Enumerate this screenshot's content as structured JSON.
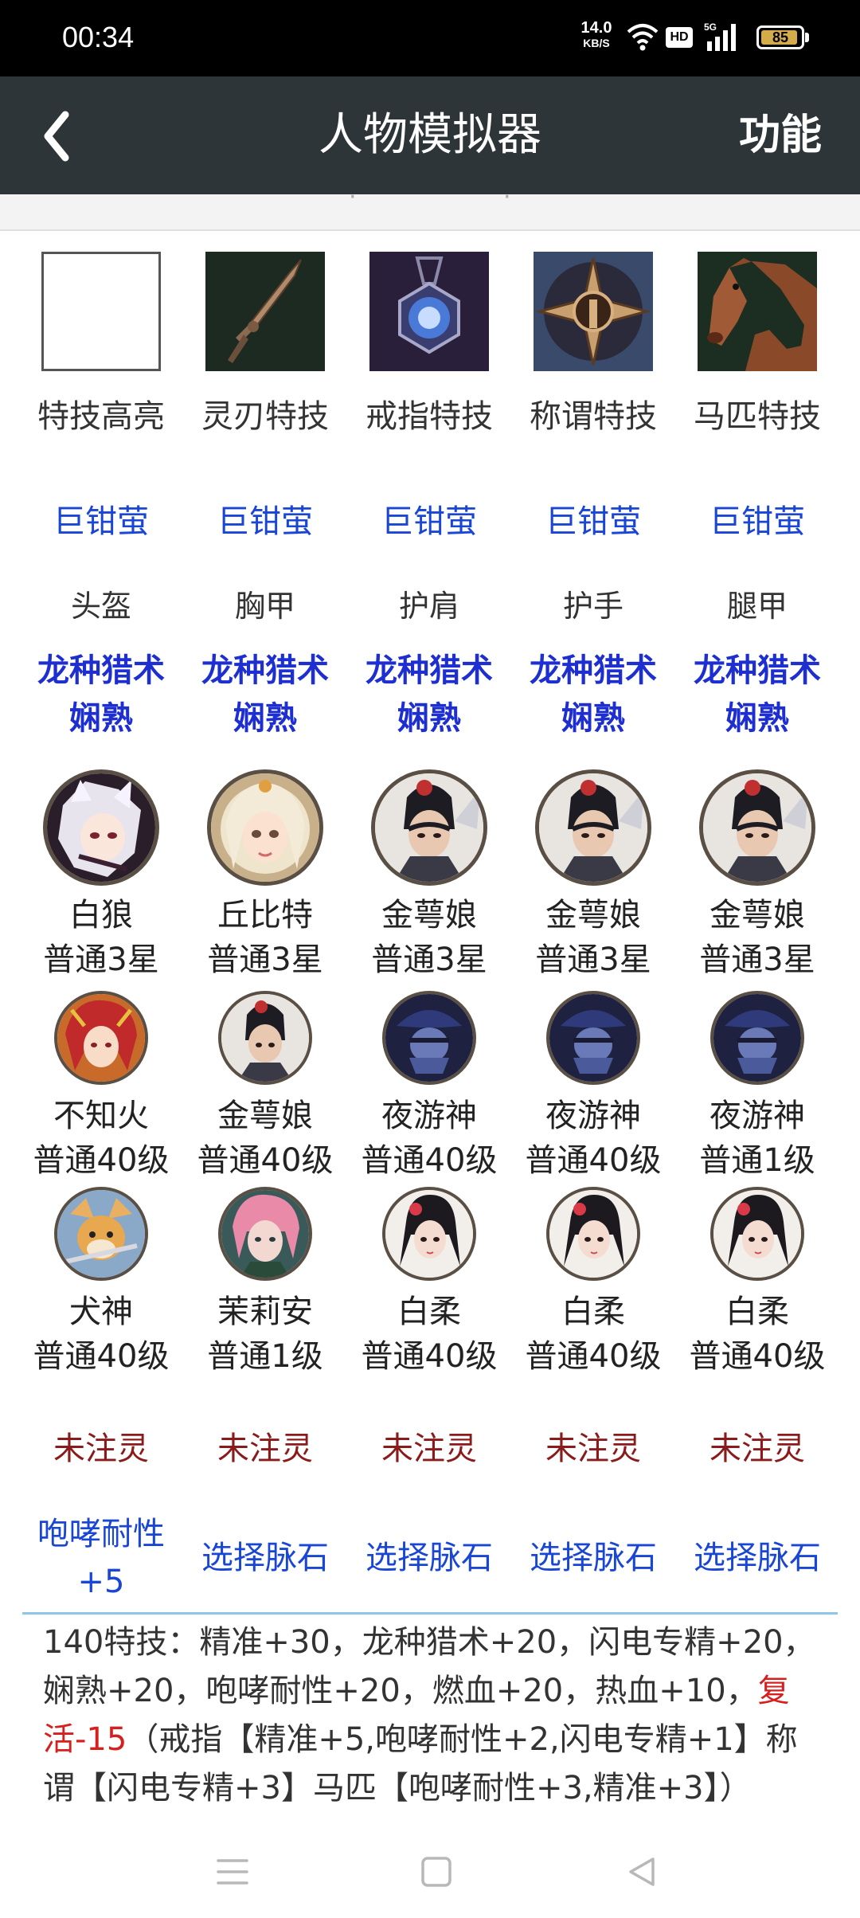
{
  "status_bar": {
    "time": "00:34",
    "net_speed": "14.0",
    "net_unit": "KB/S",
    "hd": "HD",
    "signal_label": "5G",
    "battery": "85"
  },
  "app_bar": {
    "title": "人物模拟器",
    "function_label": "功能"
  },
  "skills": [
    {
      "label": "特技高亮",
      "icon": "empty-box-icon"
    },
    {
      "label": "灵刃特技",
      "icon": "dagger-icon"
    },
    {
      "label": "戒指特技",
      "icon": "ring-icon"
    },
    {
      "label": "称谓特技",
      "icon": "emblem-icon"
    },
    {
      "label": "马匹特技",
      "icon": "horse-icon"
    }
  ],
  "set_links": [
    "巨钳萤",
    "巨钳萤",
    "巨钳萤",
    "巨钳萤",
    "巨钳萤"
  ],
  "gear_slots": [
    "头盔",
    "胸甲",
    "护肩",
    "护手",
    "腿甲"
  ],
  "gear_stats": [
    {
      "line1": "龙种猎术",
      "line2": "娴熟"
    },
    {
      "line1": "龙种猎术",
      "line2": "娴熟"
    },
    {
      "line1": "龙种猎术",
      "line2": "娴熟"
    },
    {
      "line1": "龙种猎术",
      "line2": "娴熟"
    },
    {
      "line1": "龙种猎术",
      "line2": "娴熟"
    }
  ],
  "companions_main": [
    {
      "name": "白狼",
      "grade": "普通3星",
      "avatar": "white-wolf-avatar-icon"
    },
    {
      "name": "丘比特",
      "grade": "普通3星",
      "avatar": "cupid-avatar-icon"
    },
    {
      "name": "金萼娘",
      "grade": "普通3星",
      "avatar": "jin-e-niang-avatar-icon"
    },
    {
      "name": "金萼娘",
      "grade": "普通3星",
      "avatar": "jin-e-niang-avatar-icon"
    },
    {
      "name": "金萼娘",
      "grade": "普通3星",
      "avatar": "jin-e-niang-avatar-icon"
    }
  ],
  "companions_row2": [
    {
      "name": "不知火",
      "grade": "普通40级",
      "avatar": "shiranui-avatar-icon"
    },
    {
      "name": "金萼娘",
      "grade": "普通40级",
      "avatar": "jin-e-niang-avatar-icon"
    },
    {
      "name": "夜游神",
      "grade": "普通40级",
      "avatar": "night-wanderer-avatar-icon"
    },
    {
      "name": "夜游神",
      "grade": "普通40级",
      "avatar": "night-wanderer-avatar-icon"
    },
    {
      "name": "夜游神",
      "grade": "普通1级",
      "avatar": "night-wanderer-avatar-icon"
    }
  ],
  "companions_row3": [
    {
      "name": "犬神",
      "grade": "普通40级",
      "avatar": "inugami-avatar-icon"
    },
    {
      "name": "茉莉安",
      "grade": "普通1级",
      "avatar": "marian-avatar-icon"
    },
    {
      "name": "白柔",
      "grade": "普通40级",
      "avatar": "bai-rou-avatar-icon"
    },
    {
      "name": "白柔",
      "grade": "普通40级",
      "avatar": "bai-rou-avatar-icon"
    },
    {
      "name": "白柔",
      "grade": "普通40级",
      "avatar": "bai-rou-avatar-icon"
    }
  ],
  "spirit_status": [
    "未注灵",
    "未注灵",
    "未注灵",
    "未注灵",
    "未注灵"
  ],
  "vein_stones": {
    "first_line1": "咆哮耐性",
    "first_line2": "+5",
    "others": [
      "选择脉石",
      "选择脉石",
      "选择脉石",
      "选择脉石"
    ]
  },
  "summary": {
    "text_before": "140特技：精准+30，龙种猎术+20，闪电专精+20，娴熟+20，咆哮耐性+20，燃血+20，热血+10，",
    "red_text": "复活-15",
    "text_after": "（戒指【精准+5,咆哮耐性+2,闪电专精+1】称谓【闪电专精+3】马匹【咆哮耐性+3,精准+3】）"
  },
  "colors": {
    "app_bar": "#2e3538",
    "link_blue": "#1a46d6",
    "bold_blue": "#1d2fd0",
    "spirit_red": "#8b1a1a",
    "summary_red": "#d62020",
    "divider": "#8fc5e8"
  }
}
